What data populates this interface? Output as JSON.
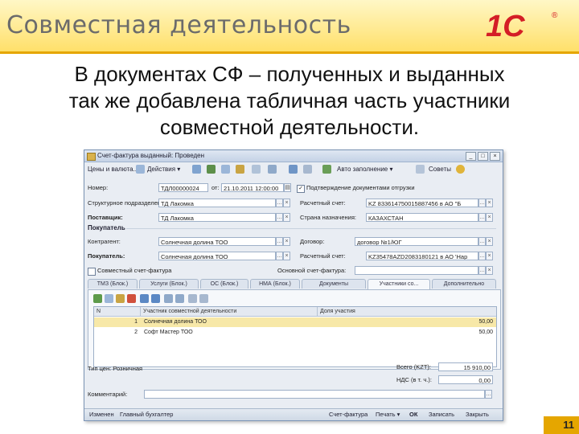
{
  "slide": {
    "title": "Совместная деятельность",
    "logo_text": "1С",
    "logo_mark": "®",
    "body_lines": [
      "В документах СФ – полученных и выданных",
      "так же добавлена табличная часть участники",
      "совместной деятельности."
    ],
    "page_number": "11",
    "colors": {
      "header_top": "#fff7c6",
      "header_bottom": "#ffe06a",
      "accent": "#e5a600",
      "logo": "#d41e26"
    }
  },
  "window": {
    "title": "Счет-фактура выданный: Проведен",
    "toolbar": {
      "deistviya_left": "Цены и валюта...",
      "actions": "Действия ▾",
      "print": "Авто заполнение ▾",
      "advice": "Советы"
    },
    "fields": {
      "number_label": "Номер:",
      "number_value": "ТДЛ00000024",
      "from_label": "от:",
      "date_value": "21.10.2011 12:00:00",
      "confirm_label": "Подтверждение документами отгрузки",
      "subdivision_label": "Структурное подразделение:",
      "subdivision_value": "ТД Лакомка",
      "account_label": "Расчетный счет:",
      "account_value": "KZ 833614750015887456 в АО \"Б",
      "supplier_label": "Поставщик:",
      "supplier_value": "ТД Лакомка",
      "country_label": "Страна назначения:",
      "country_value": "КАЗАХСТАН",
      "buyers_section": "Покупатель",
      "counterparty_label": "Контрагент:",
      "counterparty_value": "Солнечная долина ТОО",
      "contract_label": "Договор:",
      "contract_value": "договор №1/ЮГ",
      "buyer_label": "Покупатель:",
      "buyer_value": "Солнечная долина ТОО",
      "buyer_account_label": "Расчетный счет:",
      "buyer_account_value": "KZ35478AZD2083180121 в АО 'Нар",
      "joint_checkbox_label": "Совместный счет-фактура",
      "basis_label": "Основной счет-фактура:"
    },
    "tabs": [
      "ТМЗ (Блок.)",
      "Услуги (Блок.)",
      "ОС (Блок.)",
      "НМА (Блок.)",
      "Документы",
      "Участники со...",
      "Дополнительно"
    ],
    "active_tab": 5,
    "grid": {
      "headers": [
        "N",
        "Участник совместной деятельности",
        "Доля участия"
      ],
      "rows": [
        {
          "n": "1",
          "participant": "Солнечная долина ТОО",
          "share": "50,00"
        },
        {
          "n": "2",
          "participant": "Софт Мастер ТОО",
          "share": "50,00"
        }
      ]
    },
    "footer": {
      "type_label": "Тип цен: Розничная",
      "total_label": "Всего (KZT):",
      "total_value": "15 910,00",
      "vat_label": "НДС (в т. ч.):",
      "vat_value": "0,00",
      "comment_label": "Комментарий:",
      "comment_value": ""
    },
    "statusbar": {
      "left1": "Изменен",
      "left2": "Главный бухгалтер",
      "buttons": [
        "Счет-фактура",
        "Печать ▾",
        "ОК",
        "Записать",
        "Закрыть"
      ]
    }
  }
}
